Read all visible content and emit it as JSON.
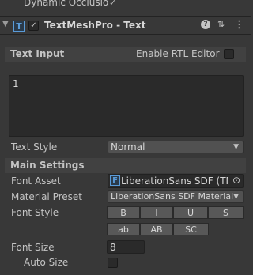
{
  "top": {
    "dynamic_occlusion_label": "Dynamic Occlusio",
    "dynamic_occlusion_checked": "✓"
  },
  "component": {
    "title": "TextMeshPro - Text",
    "enabled_check": "✓",
    "icon_glyph": "T",
    "help_glyph": "?",
    "preset_glyph": "⇅",
    "menu_glyph": "⋮"
  },
  "text_input": {
    "header": "Text Input",
    "rtl_label": "Enable RTL Editor",
    "content": "1"
  },
  "text_style": {
    "label": "Text Style",
    "value": "Normal"
  },
  "main_settings": {
    "header": "Main Settings",
    "font_asset_label": "Font Asset",
    "font_asset_value": "LiberationSans SDF (TMI",
    "font_asset_icon": "F",
    "font_asset_picker": "⊙",
    "material_preset_label": "Material Preset",
    "material_preset_value": "LiberationSans SDF Material",
    "font_style_label": "Font Style",
    "style_buttons_row1": [
      "B",
      "I",
      "U",
      "S"
    ],
    "style_buttons_row2": [
      "ab",
      "AB",
      "SC"
    ],
    "font_size_label": "Font Size",
    "font_size_value": "8",
    "auto_size_label": "Auto Size"
  },
  "colors": {
    "background": "#383838",
    "text": "#c4c4c4",
    "accent": "#5a9bd8"
  }
}
